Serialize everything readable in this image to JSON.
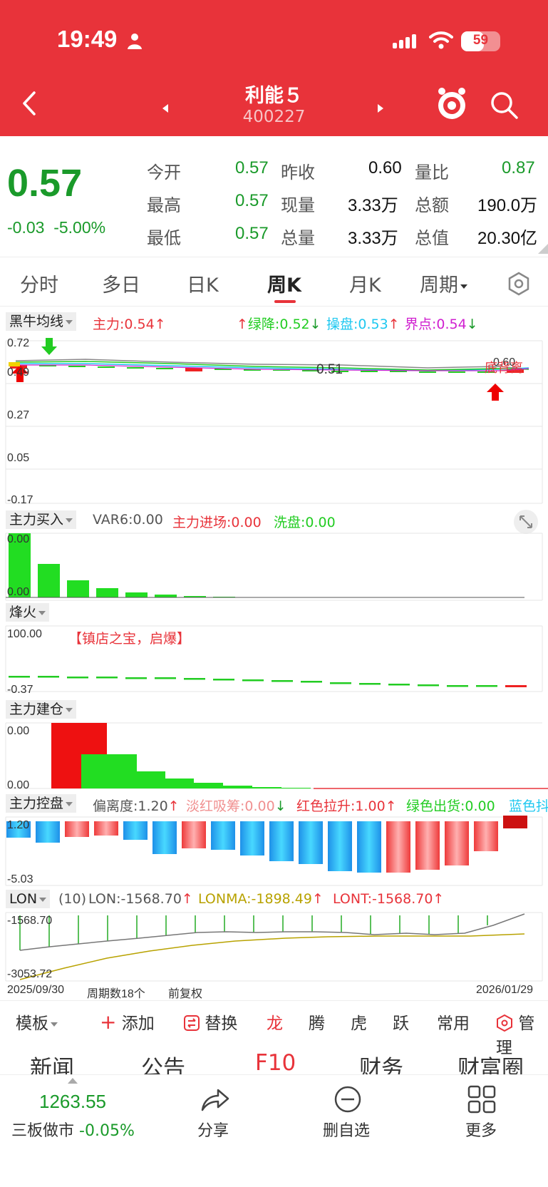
{
  "status": {
    "time": "19:49",
    "battery": "59",
    "battery_level": 0.59
  },
  "header": {
    "title": "利能５",
    "code": "400227"
  },
  "quote": {
    "price": "0.57",
    "change": "-0.03",
    "change_pct": "-5.00%",
    "fields": [
      {
        "label": "今开",
        "value": "0.57"
      },
      {
        "label": "昨收",
        "value": "0.60"
      },
      {
        "label": "量比",
        "value": "0.87"
      },
      {
        "label": "最高",
        "value": "0.57"
      },
      {
        "label": "现量",
        "value": "3.33万"
      },
      {
        "label": "总额",
        "value": "190.0万"
      },
      {
        "label": "最低",
        "value": "0.57"
      },
      {
        "label": "总量",
        "value": "3.33万"
      },
      {
        "label": "总值",
        "value": "20.30亿"
      }
    ]
  },
  "tabs": [
    "分时",
    "多日",
    "日K",
    "周K",
    "月K",
    "周期"
  ],
  "panels": {
    "p1": {
      "name": "黑牛均线",
      "zhuli": "主力:0.54",
      "lvjiang": "绿降:0.52",
      "caopan": "操盘:0.53",
      "jiedian": "界点:0.54",
      "y": [
        "0.72",
        "0.49",
        "0.27",
        "0.05",
        "-0.17"
      ],
      "mid": "0.51",
      "right_label": "底背离",
      "right_value": "0.60"
    },
    "p2": {
      "name": "主力买入",
      "var6": "VAR6:0.00",
      "jinchang": "主力进场:0.00",
      "xipan": "洗盘:0.00",
      "y": [
        "0.00",
        "0.00"
      ]
    },
    "p3": {
      "name": "烽火",
      "note": "【镇店之宝，启爆】",
      "y": [
        "100.00",
        "-0.37"
      ]
    },
    "p4": {
      "name": "主力建仓",
      "y": [
        "0.00",
        "0.00"
      ]
    },
    "p5": {
      "name": "主力控盘",
      "pianli": "偏离度:1.20",
      "danhong": "淡红吸筹:0.00",
      "hongse": "红色拉升:1.00",
      "lvse": "绿色出货:0.00",
      "lanse": "蓝色抖",
      "y": [
        "1.20",
        "-5.03"
      ]
    },
    "p6": {
      "name": "LON",
      "period": "(10)",
      "lon": "LON:-1568.70",
      "lonma": "LONMA:-1898.49",
      "lont": "LONT:-1568.70",
      "y": [
        "-1568.70",
        "-3053.72"
      ]
    }
  },
  "date_row": {
    "start": "2025/09/30",
    "periods": "周期数18个",
    "adjust": "前复权",
    "end": "2026/01/29"
  },
  "toolbar": [
    "模板",
    "添加",
    "替换",
    "龙",
    "腾",
    "虎",
    "跃",
    "常用",
    "管理"
  ],
  "nav": [
    "新闻",
    "公告",
    "F10",
    "财务",
    "财富圈"
  ],
  "footer": {
    "index_value": "1263.55",
    "index_name": "三板做市",
    "index_change": "-0.05%",
    "share": "分享",
    "remove": "删自选",
    "more": "更多"
  },
  "colors": {
    "red": "#e8333a",
    "green": "#1a9a2a",
    "cyan": "#1ec8f0",
    "magenta": "#d020d0"
  }
}
